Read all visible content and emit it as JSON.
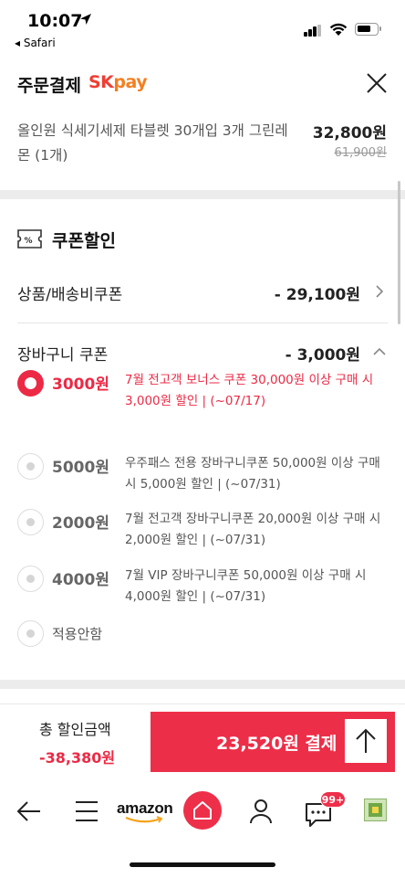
{
  "status_bar": {
    "time": "10:07",
    "back_app": "◂ Safari"
  },
  "header": {
    "title": "주문결제",
    "brand_sk": "SK",
    "brand_pay": "pay",
    "close_icon": "close-icon"
  },
  "product": {
    "name": "올인원 식세기세제 타블렛 30개입 3개 그린레몬 (1개)",
    "price": "32,800원",
    "original_price": "61,900원"
  },
  "coupon_section": {
    "title": "쿠폰할인",
    "product_shipping_coupon": {
      "label": "상품/배송비쿠폰",
      "amount": "- 29,100원"
    },
    "cart_coupon": {
      "label": "장바구니 쿠폰",
      "amount": "- 3,000원"
    },
    "options": [
      {
        "amount": "3000원",
        "desc": "7월 전고객 보너스 쿠폰 30,000원 이상 구매 시 3,000원 할인 | (~07/17)",
        "selected": true
      },
      {
        "amount": "5000원",
        "desc": "우주패스 전용 장바구니쿠폰 50,000원 이상 구매 시 5,000원 할인 | (~07/31)",
        "selected": false
      },
      {
        "amount": "2000원",
        "desc": "7월 전고객 장바구니쿠폰 20,000원 이상 구매 시 2,000원 할인 | (~07/31)",
        "selected": false
      },
      {
        "amount": "4000원",
        "desc": "7월 VIP 장바구니쿠폰 50,000원 이상 구매 시 4,000원 할인 | (~07/31)",
        "selected": false
      }
    ],
    "none_option": "적용안함"
  },
  "footer": {
    "total_label": "총 할인금액",
    "total_value": "-38,380원",
    "pay_label": "23,520원 결제"
  },
  "bottom_nav": {
    "amazon": "amazon",
    "chat_badge": "99+"
  },
  "colors": {
    "accent": "#ED2E48",
    "sk_red": "#EF3E33",
    "pay_orange": "#F47F20"
  }
}
